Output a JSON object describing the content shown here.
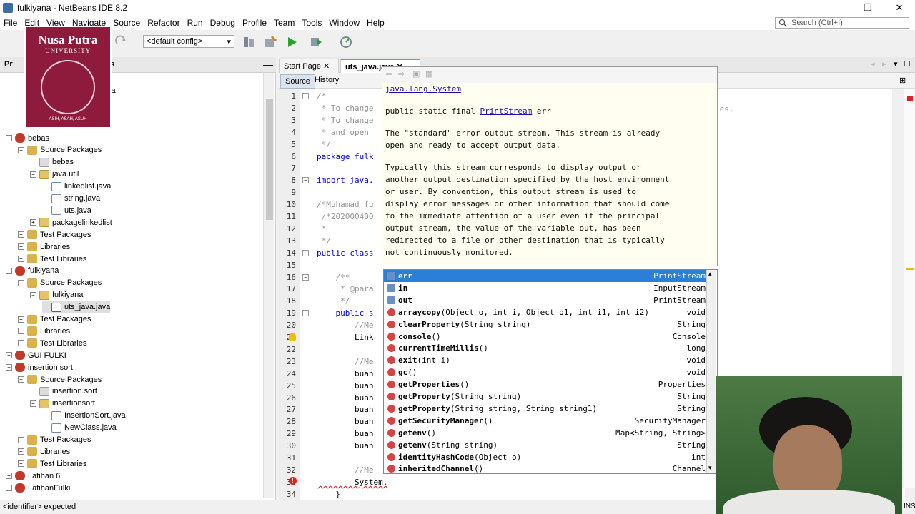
{
  "window": {
    "title": "fulkiyana - NetBeans IDE 8.2",
    "minimize": "—",
    "restore": "❐",
    "close": "✕"
  },
  "menu": [
    "File",
    "Edit",
    "View",
    "Navigate",
    "Source",
    "Refactor",
    "Run",
    "Debug",
    "Profile",
    "Team",
    "Tools",
    "Window",
    "Help"
  ],
  "search": {
    "placeholder": "Search (Ctrl+I)"
  },
  "toolbar": {
    "config": "<default config>"
  },
  "logo": {
    "line1": "Nusa Putra",
    "line2": "— UNIVERSITY —",
    "motto": "ASIH, ASAH, ASUH"
  },
  "projects": {
    "tab_label": "Pr",
    "tab2_label": "es",
    "partial_item": "va",
    "tree": [
      {
        "label": "bebas",
        "icon": "project-icon"
      },
      {
        "label": "Source Packages",
        "icon": "package-root-icon"
      },
      {
        "label": "bebas",
        "icon": "empty-package-icon"
      },
      {
        "label": "java.util",
        "icon": "package-icon"
      },
      {
        "label": "linkedlist.java",
        "icon": "java-file-icon"
      },
      {
        "label": "string.java",
        "icon": "java-file-icon"
      },
      {
        "label": "uts.java",
        "icon": "java-file-icon"
      },
      {
        "label": "packagelinkedlist",
        "icon": "package-icon"
      },
      {
        "label": "Test Packages",
        "icon": "test-packages-icon"
      },
      {
        "label": "Libraries",
        "icon": "libraries-icon"
      },
      {
        "label": "Test Libraries",
        "icon": "libraries-icon"
      },
      {
        "label": "fulkiyana",
        "icon": "project-icon"
      },
      {
        "label": "Source Packages",
        "icon": "package-root-icon"
      },
      {
        "label": "fulkiyana",
        "icon": "package-error-icon"
      },
      {
        "label": "uts_java.java",
        "icon": "java-error-icon"
      },
      {
        "label": "Test Packages",
        "icon": "test-packages-icon"
      },
      {
        "label": "Libraries",
        "icon": "libraries-icon"
      },
      {
        "label": "Test Libraries",
        "icon": "libraries-icon"
      },
      {
        "label": "GUI FULKI",
        "icon": "project-icon"
      },
      {
        "label": "insertion sort",
        "icon": "project-icon"
      },
      {
        "label": "Source Packages",
        "icon": "package-root-icon"
      },
      {
        "label": "insertion.sort",
        "icon": "empty-package-icon"
      },
      {
        "label": "insertionsort",
        "icon": "package-icon"
      },
      {
        "label": "InsertionSort.java",
        "icon": "java-file-icon"
      },
      {
        "label": "NewClass.java",
        "icon": "java-file-icon"
      },
      {
        "label": "Test Packages",
        "icon": "test-packages-icon"
      },
      {
        "label": "Libraries",
        "icon": "libraries-icon"
      },
      {
        "label": "Test Libraries",
        "icon": "libraries-icon"
      },
      {
        "label": "Latihan 6",
        "icon": "project-icon"
      },
      {
        "label": "LatihanFulki",
        "icon": "project-icon"
      }
    ]
  },
  "editor": {
    "tabs": [
      "Start Page",
      "uts_java.java"
    ],
    "source_label": "Source",
    "history_label": "History",
    "line_numbers": [
      "1",
      "2",
      "3",
      "4",
      "5",
      "6",
      "7",
      "8",
      "9",
      "10",
      "11",
      "12",
      "13",
      "14",
      "15",
      "16",
      "17",
      "18",
      "19",
      "20",
      "21",
      "22",
      "23",
      "24",
      "25",
      "26",
      "27",
      "28",
      "29",
      "30",
      "31",
      "32",
      "33",
      "34"
    ],
    "code": [
      "/*",
      " * To change",
      " * To change",
      " * and open",
      " */",
      "package fulk",
      "",
      "import java.",
      "",
      "/*Muhamad fu",
      " /*202000400",
      " *",
      " */",
      "public class",
      "",
      "    /**",
      "     * @para",
      "     */",
      "    public s",
      "        //Me",
      "        Link",
      "",
      "        //Me",
      "        buah",
      "        buah",
      "        buah",
      "        buah",
      "        buah",
      "        buah",
      "        buah",
      "",
      "        //Me",
      "        System.",
      "    }"
    ],
    "overflow_text": "ies."
  },
  "javadoc": {
    "class_link": "java.lang.System",
    "signature_prefix": "public static final ",
    "signature_type": "PrintStream",
    "signature_suffix": " err",
    "para1": "The \"standard\" error output stream. This stream is already\nopen and ready to accept output data.",
    "para2": "Typically this stream corresponds to display output or\nanother output destination specified by the host environment\nor user. By convention, this output stream is used to\ndisplay error messages or other information that should come\nto the immediate attention of a user even if the principal\noutput stream, the value of the variable out, has been\nredirected to a file or other destination that is typically\nnot continuously monitored."
  },
  "completion": [
    {
      "name": "err",
      "params": "",
      "type": "PrintStream",
      "kind": "field"
    },
    {
      "name": "in",
      "params": "",
      "type": "InputStream",
      "kind": "field"
    },
    {
      "name": "out",
      "params": "",
      "type": "PrintStream",
      "kind": "field"
    },
    {
      "name": "arraycopy",
      "params": "(Object o, int i, Object o1, int i1, int i2)",
      "type": "void",
      "kind": "method"
    },
    {
      "name": "clearProperty",
      "params": "(String string)",
      "type": "String",
      "kind": "method"
    },
    {
      "name": "console",
      "params": "()",
      "type": "Console",
      "kind": "method"
    },
    {
      "name": "currentTimeMillis",
      "params": "()",
      "type": "long",
      "kind": "method"
    },
    {
      "name": "exit",
      "params": "(int i)",
      "type": "void",
      "kind": "method"
    },
    {
      "name": "gc",
      "params": "()",
      "type": "void",
      "kind": "method"
    },
    {
      "name": "getProperties",
      "params": "()",
      "type": "Properties",
      "kind": "method"
    },
    {
      "name": "getProperty",
      "params": "(String string)",
      "type": "String",
      "kind": "method"
    },
    {
      "name": "getProperty",
      "params": "(String string, String string1)",
      "type": "String",
      "kind": "method"
    },
    {
      "name": "getSecurityManager",
      "params": "()",
      "type": "SecurityManager",
      "kind": "method"
    },
    {
      "name": "getenv",
      "params": "()",
      "type": "Map<String, String>",
      "kind": "method"
    },
    {
      "name": "getenv",
      "params": "(String string)",
      "type": "String",
      "kind": "method"
    },
    {
      "name": "identityHashCode",
      "params": "(Object o)",
      "type": "int",
      "kind": "method"
    },
    {
      "name": "inheritedChannel",
      "params": "()",
      "type": "Channel",
      "kind": "method"
    }
  ],
  "status": {
    "message": "<identifier> expected",
    "right": "INS"
  }
}
